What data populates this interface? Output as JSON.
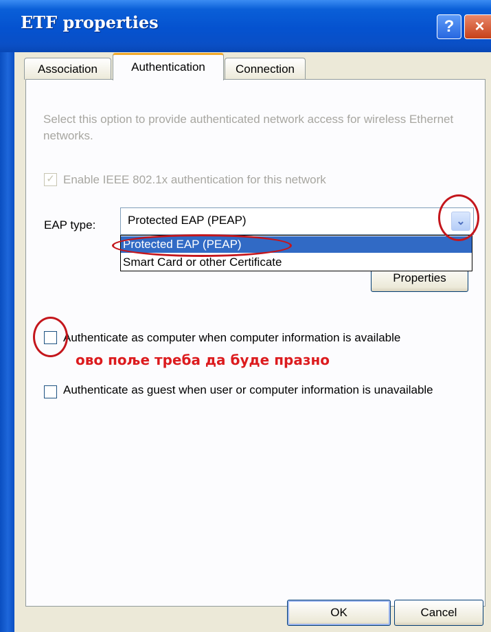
{
  "window": {
    "title": "ETF properties"
  },
  "titlebar": {
    "help_glyph": "?",
    "close_glyph": "×"
  },
  "tabs": [
    {
      "label": "Association",
      "active": false
    },
    {
      "label": "Authentication",
      "active": true
    },
    {
      "label": "Connection",
      "active": false
    }
  ],
  "auth": {
    "description": "Select this option to provide authenticated network access for wireless Ethernet networks.",
    "enable_8021x": {
      "label": "Enable IEEE 802.1x authentication for this network",
      "checked": true,
      "disabled": true
    },
    "eap_type": {
      "label": "EAP type:",
      "value": "Protected EAP (PEAP)",
      "options": [
        "Protected EAP (PEAP)",
        "Smart Card or other Certificate"
      ],
      "selected_index": 0
    },
    "properties_button": "Properties",
    "authenticate_computer": {
      "label": "Authenticate as computer when computer information is available",
      "checked": false
    },
    "annotation": "ово поље треба да буде празно",
    "authenticate_guest": {
      "label": "Authenticate as guest when user or computer information is unavailable",
      "checked": false
    }
  },
  "buttons": {
    "ok": "OK",
    "cancel": "Cancel"
  },
  "colors": {
    "annotation_red": "#dc1b1e",
    "selection_blue": "#316ac5",
    "titlebar_blue": "#0552cf",
    "tab_highlight": "#f1a92a"
  },
  "icons": {
    "checkmark": "checkmark-icon",
    "combo_arrow": "chevron-down-icon"
  }
}
